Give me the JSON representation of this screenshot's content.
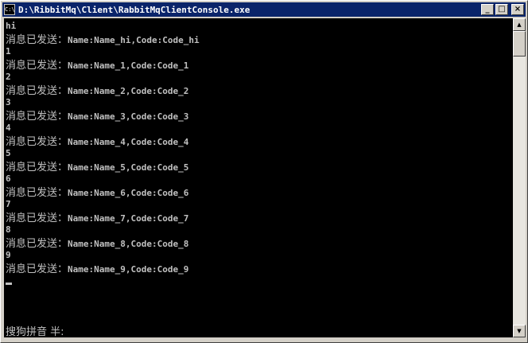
{
  "window": {
    "title": "D:\\RibbitMq\\Client\\RabbitMqClientConsole.exe",
    "icon_label": "C:\\",
    "icon_name": "console-app-icon",
    "buttons": {
      "minimize": "_",
      "maximize": "□",
      "close": "×"
    },
    "colors": {
      "titlebar": "#0a246a",
      "console_bg": "#000000",
      "console_text": "#c0c0c0"
    }
  },
  "console": {
    "lines": [
      {
        "kind": "input",
        "text": "hi"
      },
      {
        "kind": "msg",
        "prefix": "消息已发送：",
        "body": "Name:Name_hi,Code:Code_hi"
      },
      {
        "kind": "input",
        "text": "1"
      },
      {
        "kind": "msg",
        "prefix": "消息已发送：",
        "body": "Name:Name_1,Code:Code_1"
      },
      {
        "kind": "input",
        "text": "2"
      },
      {
        "kind": "msg",
        "prefix": "消息已发送：",
        "body": "Name:Name_2,Code:Code_2"
      },
      {
        "kind": "input",
        "text": "3"
      },
      {
        "kind": "msg",
        "prefix": "消息已发送：",
        "body": "Name:Name_3,Code:Code_3"
      },
      {
        "kind": "input",
        "text": "4"
      },
      {
        "kind": "msg",
        "prefix": "消息已发送：",
        "body": "Name:Name_4,Code:Code_4"
      },
      {
        "kind": "input",
        "text": "5"
      },
      {
        "kind": "msg",
        "prefix": "消息已发送：",
        "body": "Name:Name_5,Code:Code_5"
      },
      {
        "kind": "input",
        "text": "6"
      },
      {
        "kind": "msg",
        "prefix": "消息已发送：",
        "body": "Name:Name_6,Code:Code_6"
      },
      {
        "kind": "input",
        "text": "7"
      },
      {
        "kind": "msg",
        "prefix": "消息已发送：",
        "body": "Name:Name_7,Code:Code_7"
      },
      {
        "kind": "input",
        "text": "8"
      },
      {
        "kind": "msg",
        "prefix": "消息已发送：",
        "body": "Name:Name_8,Code:Code_8"
      },
      {
        "kind": "input",
        "text": "9"
      },
      {
        "kind": "msg",
        "prefix": "消息已发送：",
        "body": "Name:Name_9,Code:Code_9"
      }
    ],
    "ime_status": "搜狗拼音 半:"
  }
}
